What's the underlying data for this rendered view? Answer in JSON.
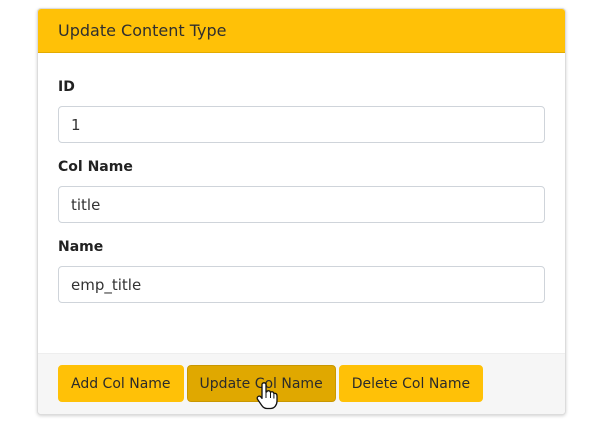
{
  "header": {
    "title": "Update Content Type"
  },
  "form": {
    "id": {
      "label": "ID",
      "value": "1"
    },
    "col_name": {
      "label": "Col Name",
      "value": "title"
    },
    "name": {
      "label": "Name",
      "value": "emp_title"
    }
  },
  "footer": {
    "add_label": "Add Col Name",
    "update_label": "Update Col Name",
    "delete_label": "Delete Col Name"
  },
  "colors": {
    "accent": "#ffc107",
    "accent_active": "#e0a800"
  },
  "icons": {
    "cursor": "hand-pointer-icon"
  }
}
